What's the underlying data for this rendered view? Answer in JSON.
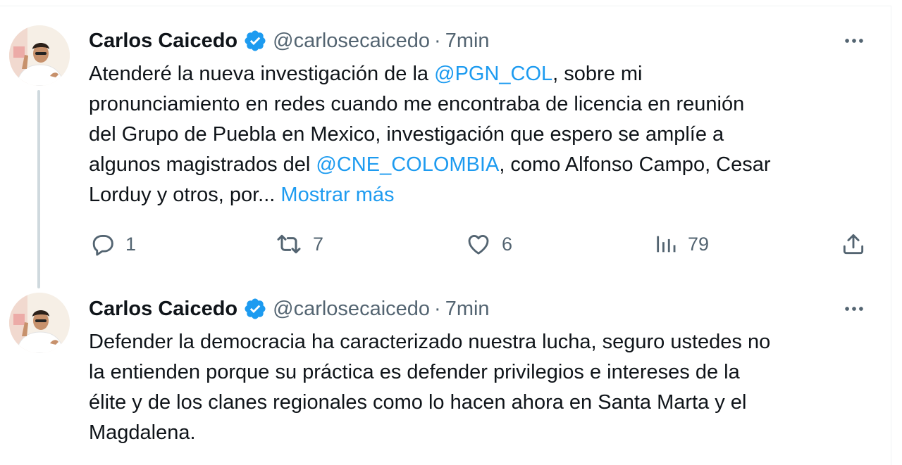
{
  "tweets": [
    {
      "author": {
        "name": "Carlos Caicedo",
        "handle": "@carlosecaicedo",
        "verified": true,
        "avatar_icon": "profile-photo"
      },
      "separator": "·",
      "time": "7min",
      "body_lines": [
        [
          {
            "text": "Atenderé la nueva investigación de la "
          },
          {
            "text": "@PGN_COL",
            "link": true
          },
          {
            "text": ", sobre mi"
          }
        ],
        [
          {
            "text": "pronunciamiento en redes cuando me encontraba de licencia en reunión"
          }
        ],
        [
          {
            "text": "del Grupo de Puebla en Mexico, investigación que espero se amplíe a"
          }
        ],
        [
          {
            "text": "algunos magistrados del "
          },
          {
            "text": "@CNE_COLOMBIA",
            "link": true
          },
          {
            "text": ", como Alfonso Campo, Cesar"
          }
        ],
        [
          {
            "text": "Lorduy y otros, por... "
          },
          {
            "text": "Mostrar más",
            "link": true
          }
        ]
      ],
      "actions": {
        "replies": "1",
        "retweets": "7",
        "likes": "6",
        "views": "79"
      }
    },
    {
      "author": {
        "name": "Carlos Caicedo",
        "handle": "@carlosecaicedo",
        "verified": true,
        "avatar_icon": "profile-photo"
      },
      "separator": "·",
      "time": "7min",
      "body_lines": [
        [
          {
            "text": "Defender la democracia ha caracterizado nuestra lucha, seguro ustedes no"
          }
        ],
        [
          {
            "text": "la entienden porque su práctica es defender privilegios e intereses de la"
          }
        ],
        [
          {
            "text": "élite y de los clanes regionales como lo hacen ahora en Santa Marta y el"
          }
        ],
        [
          {
            "text": "Magdalena."
          }
        ]
      ]
    }
  ],
  "colors": {
    "text_primary": "#0f1419",
    "text_secondary": "#536471",
    "link": "#1d9bf0",
    "verified_badge": "#1d9bf0",
    "thread_line": "#cfd9de"
  },
  "icons": {
    "reply": "speech-bubble-icon",
    "retweet": "retweet-arrows-icon",
    "like": "heart-icon",
    "views": "bar-chart-icon",
    "share": "upload-share-icon",
    "more": "three-dots-icon",
    "verified": "verified-badge-icon"
  }
}
